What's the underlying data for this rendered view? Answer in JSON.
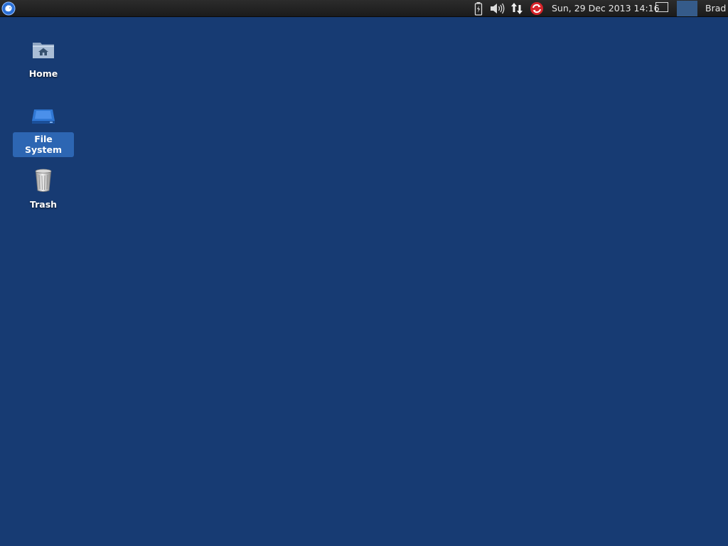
{
  "panel": {
    "menu_icon": "xfce-mouse-icon",
    "tray": [
      {
        "name": "battery-icon"
      },
      {
        "name": "volume-icon"
      },
      {
        "name": "network-icon"
      },
      {
        "name": "update-notifier-icon"
      }
    ],
    "clock": "Sun, 29 Dec 2013 14:16",
    "user": "Brad"
  },
  "desktop": {
    "background_color": "#173b73",
    "icons": [
      {
        "label": "Home",
        "icon": "home-folder-icon",
        "selected": false
      },
      {
        "label": "File System",
        "icon": "hard-drive-icon",
        "selected": true
      },
      {
        "label": "Trash",
        "icon": "trash-icon",
        "selected": false
      }
    ]
  }
}
